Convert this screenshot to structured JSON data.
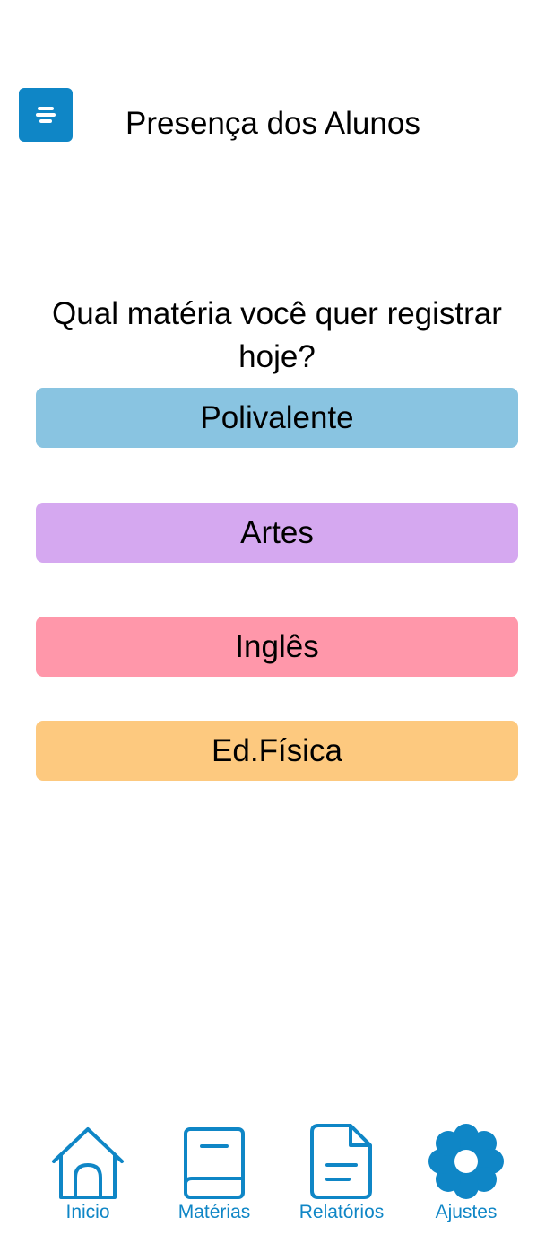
{
  "header": {
    "title": "Presença dos Alunos",
    "menu_icon": "menu-icon"
  },
  "question": "Qual matéria você quer registrar hoje?",
  "subjects": [
    {
      "label": "Polivalente",
      "color": "#89c4e1"
    },
    {
      "label": "Artes",
      "color": "#d5a8f0"
    },
    {
      "label": "Inglês",
      "color": "#ff97aa"
    },
    {
      "label": "Ed.Física",
      "color": "#fdc97f"
    }
  ],
  "nav": {
    "accent": "#0f86c6",
    "items": [
      {
        "label": "Inicio",
        "icon": "home-icon"
      },
      {
        "label": "Matérias",
        "icon": "book-icon"
      },
      {
        "label": "Relatórios",
        "icon": "document-icon"
      },
      {
        "label": "Ajustes",
        "icon": "gear-icon"
      }
    ]
  }
}
